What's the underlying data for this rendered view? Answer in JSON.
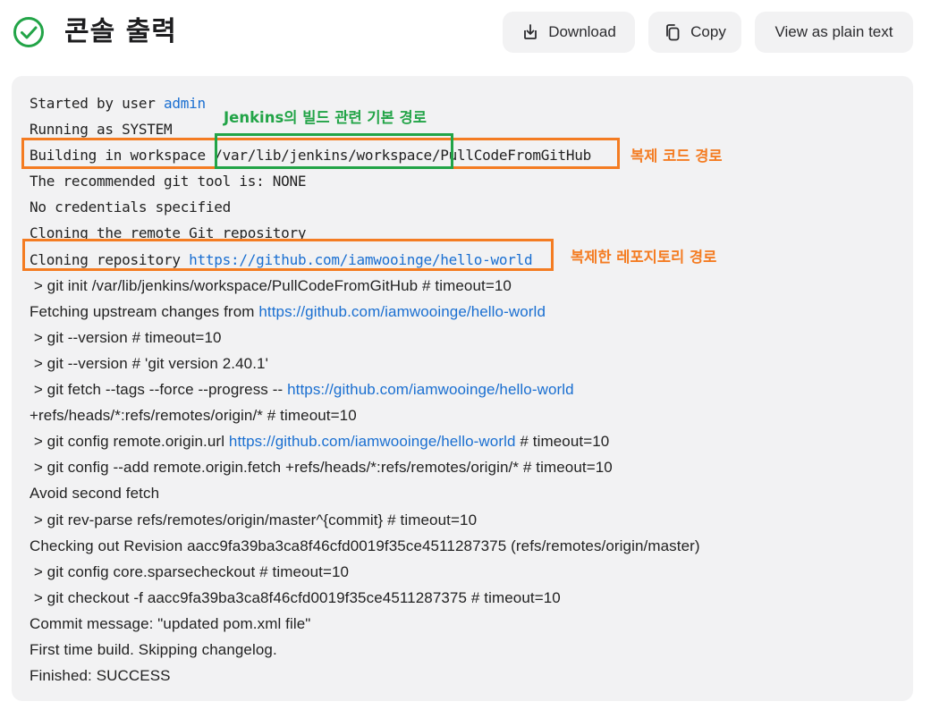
{
  "header": {
    "title": "콘솔 출력",
    "buttons": {
      "download": "Download",
      "copy": "Copy",
      "plain": "View as plain text"
    }
  },
  "colors": {
    "success": "#22a447",
    "link": "#1a6fd1",
    "annotation_orange": "#f47c22",
    "annotation_green": "#22a447"
  },
  "console": {
    "l01": {
      "text": "Started by user ",
      "user": "admin"
    },
    "l02": {
      "text": "Running as SYSTEM"
    },
    "l03": {
      "prefix": "Building in workspace ",
      "path_base": "/var/lib/jenkins/workspace/",
      "path_job": "PullCodeFromGitHub"
    },
    "l04": {
      "text": "The recommended git tool is: NONE"
    },
    "l05": {
      "text": "No credentials specified"
    },
    "l06": {
      "text": "Cloning the remote Git repository"
    },
    "l07": {
      "prefix": "Cloning repository ",
      "url": "https://github.com/iamwooinge/hello-world"
    },
    "l08": {
      "text": " > git init /var/lib/jenkins/workspace/PullCodeFromGitHub # timeout=10"
    },
    "l09": {
      "prefix": "Fetching upstream changes from ",
      "url": "https://github.com/iamwooinge/hello-world"
    },
    "l10": {
      "text": " > git --version # timeout=10"
    },
    "l11": {
      "text": " > git --version # 'git version 2.40.1'"
    },
    "l12": {
      "prefix": " > git fetch --tags --force --progress -- ",
      "url": "https://github.com/iamwooinge/hello-world"
    },
    "l13": {
      "text": "+refs/heads/*:refs/remotes/origin/* # timeout=10"
    },
    "l14": {
      "prefix": " > git config remote.origin.url ",
      "url": "https://github.com/iamwooinge/hello-world",
      "suffix": " # timeout=10"
    },
    "l15": {
      "text": " > git config --add remote.origin.fetch +refs/heads/*:refs/remotes/origin/* # timeout=10"
    },
    "l16": {
      "text": "Avoid second fetch"
    },
    "l17": {
      "text": " > git rev-parse refs/remotes/origin/master^{commit} # timeout=10"
    },
    "l18": {
      "text": "Checking out Revision aacc9fa39ba3ca8f46cfd0019f35ce4511287375 (refs/remotes/origin/master)"
    },
    "l19": {
      "text": " > git config core.sparsecheckout # timeout=10"
    },
    "l20": {
      "text": " > git checkout -f aacc9fa39ba3ca8f46cfd0019f35ce4511287375 # timeout=10"
    },
    "l21": {
      "text": "Commit message: \"updated pom.xml file\""
    },
    "l22": {
      "text": "First time build. Skipping changelog."
    },
    "l23": {
      "text": "Finished: SUCCESS"
    }
  },
  "annotations": {
    "jenkins_base": "Jenkins의 빌드 관련 기본 경로",
    "code_path": "복제 코드 경로",
    "repo_path": "복제한 레포지토리 경로"
  }
}
